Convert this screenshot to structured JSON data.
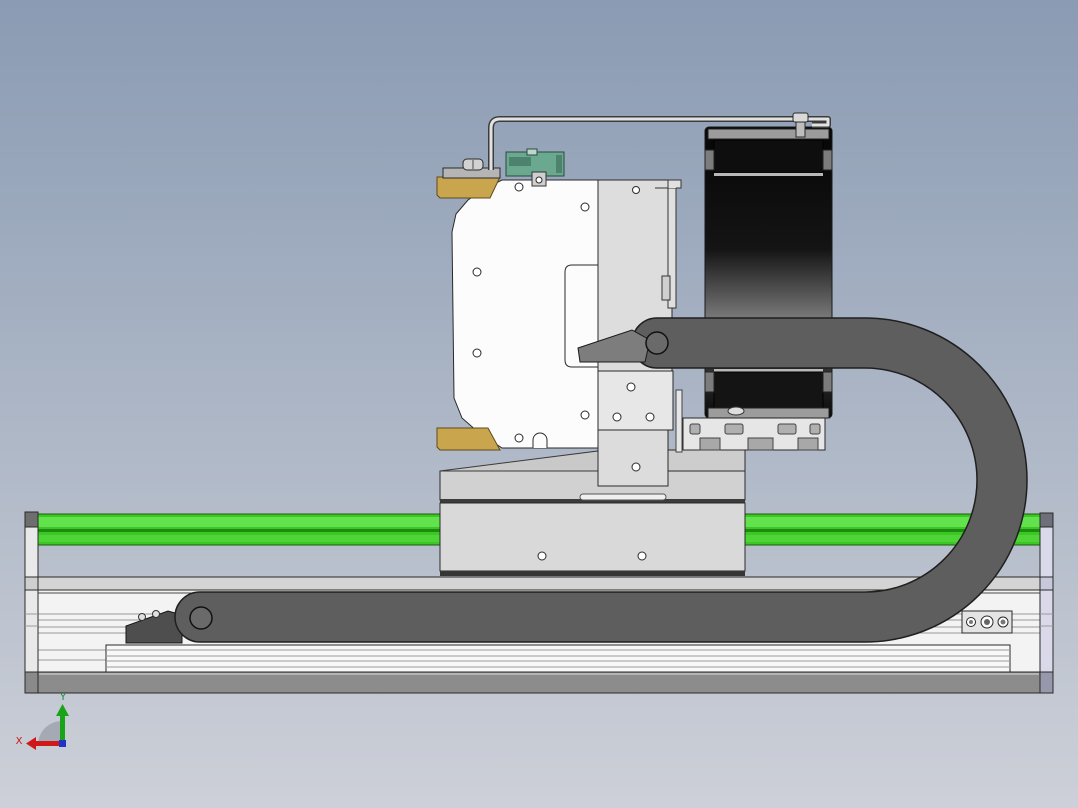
{
  "viewport": {
    "triad": {
      "icon": "axis-triad",
      "x_label": "X",
      "y_label": "Y"
    }
  },
  "colors": {
    "background_top": "#8a9bb3",
    "background_bottom": "#cdd0d8",
    "rail_green": "#3cc824",
    "cable_chain": "#5e5e5e",
    "brass_pad": "#c9a54e",
    "sensor_green": "#6aa88f",
    "axis_x": "#d01818",
    "axis_y": "#19a319",
    "axis_z": "#2233cc"
  }
}
